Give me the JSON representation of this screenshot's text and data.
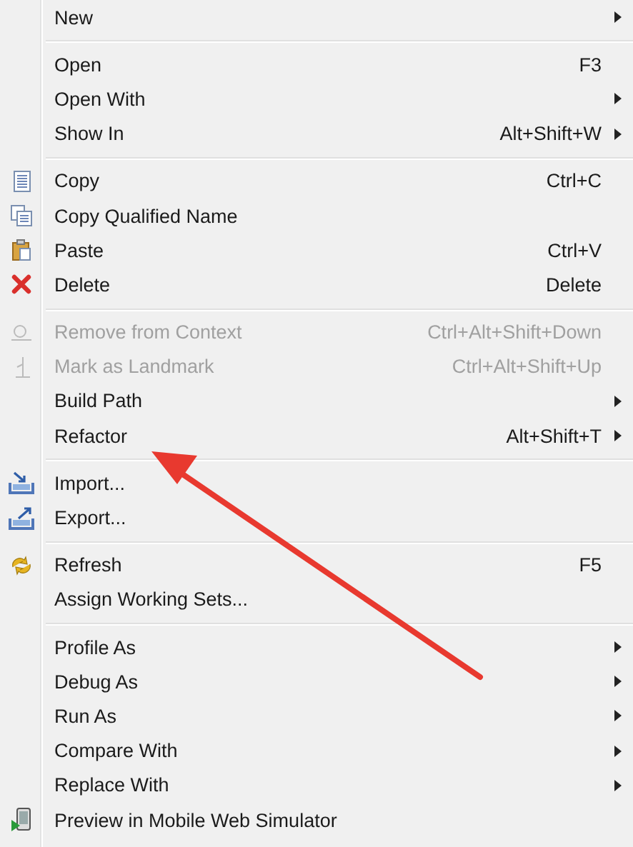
{
  "menu": {
    "groups": [
      {
        "items": [
          {
            "label": "New",
            "submenu": true,
            "disabled": false
          }
        ]
      },
      {
        "items": [
          {
            "label": "Open",
            "shortcut": "F3",
            "submenu": false,
            "disabled": false
          },
          {
            "label": "Open With",
            "submenu": true,
            "disabled": false
          },
          {
            "label": "Show In",
            "shortcut": "Alt+Shift+W",
            "submenu": true,
            "disabled": false
          }
        ]
      },
      {
        "items": [
          {
            "label": "Copy",
            "shortcut": "Ctrl+C",
            "submenu": false,
            "disabled": false
          },
          {
            "label": "Copy Qualified Name",
            "submenu": false,
            "disabled": false
          },
          {
            "label": "Paste",
            "shortcut": "Ctrl+V",
            "submenu": false,
            "disabled": false
          },
          {
            "label": "Delete",
            "shortcut": "Delete",
            "submenu": false,
            "disabled": false
          }
        ]
      },
      {
        "items": [
          {
            "label": "Remove from Context",
            "shortcut": "Ctrl+Alt+Shift+Down",
            "submenu": false,
            "disabled": true
          },
          {
            "label": "Mark as Landmark",
            "shortcut": "Ctrl+Alt+Shift+Up",
            "submenu": false,
            "disabled": true
          },
          {
            "label": "Build Path",
            "submenu": true,
            "disabled": false
          },
          {
            "label": "Refactor",
            "shortcut": "Alt+Shift+T",
            "submenu": true,
            "disabled": false
          }
        ]
      },
      {
        "items": [
          {
            "label": "Import...",
            "submenu": false,
            "disabled": false
          },
          {
            "label": "Export...",
            "submenu": false,
            "disabled": false
          }
        ]
      },
      {
        "items": [
          {
            "label": "Refresh",
            "shortcut": "F5",
            "submenu": false,
            "disabled": false
          },
          {
            "label": "Assign Working Sets...",
            "submenu": false,
            "disabled": false
          }
        ]
      },
      {
        "items": [
          {
            "label": "Profile As",
            "submenu": true,
            "disabled": false
          },
          {
            "label": "Debug As",
            "submenu": true,
            "disabled": false
          },
          {
            "label": "Run As",
            "submenu": true,
            "disabled": false
          },
          {
            "label": "Compare With",
            "submenu": true,
            "disabled": false
          },
          {
            "label": "Replace With",
            "submenu": true,
            "disabled": false
          },
          {
            "label": "Preview in Mobile Web Simulator",
            "submenu": false,
            "disabled": false
          }
        ]
      }
    ]
  }
}
